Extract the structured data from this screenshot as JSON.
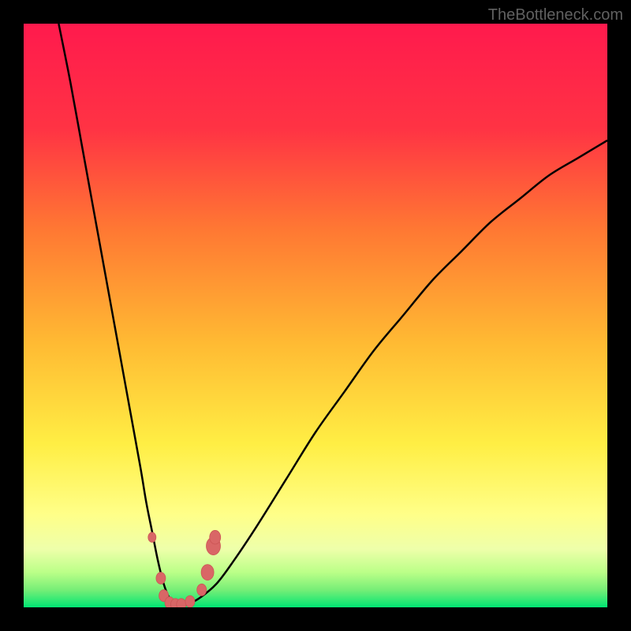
{
  "watermark": "TheBottleneck.com",
  "colors": {
    "bg": "#000000",
    "gradient_top": "#ff1a4d",
    "gradient_mid1": "#ff8a33",
    "gradient_mid2": "#ffd633",
    "gradient_mid3": "#ffff66",
    "gradient_low": "#ccff66",
    "gradient_bottom": "#00e673",
    "curve": "#000000",
    "markers_fill": "#d96666",
    "markers_stroke": "#cc5555"
  },
  "chart_data": {
    "type": "line",
    "title": "",
    "xlabel": "",
    "ylabel": "",
    "xlim": [
      0,
      100
    ],
    "ylim": [
      0,
      100
    ],
    "series": [
      {
        "name": "bottleneck-curve",
        "x": [
          6,
          8,
          10,
          12,
          14,
          16,
          18,
          20,
          21,
          22,
          23,
          24,
          25,
          26,
          27,
          28,
          30,
          33,
          36,
          40,
          45,
          50,
          55,
          60,
          65,
          70,
          75,
          80,
          85,
          90,
          95,
          100
        ],
        "y": [
          100,
          90,
          79,
          68,
          57,
          46,
          35,
          24,
          18,
          13,
          8,
          4,
          1.5,
          0.5,
          0.3,
          0.5,
          1.5,
          4,
          8,
          14,
          22,
          30,
          37,
          44,
          50,
          56,
          61,
          66,
          70,
          74,
          77,
          80
        ]
      }
    ],
    "markers": [
      {
        "x": 22.0,
        "y": 12.0,
        "r": 5
      },
      {
        "x": 23.5,
        "y": 5.0,
        "r": 6
      },
      {
        "x": 24.0,
        "y": 2.0,
        "r": 6
      },
      {
        "x": 25.0,
        "y": 0.8,
        "r": 6
      },
      {
        "x": 26.0,
        "y": 0.5,
        "r": 6
      },
      {
        "x": 27.0,
        "y": 0.5,
        "r": 6
      },
      {
        "x": 28.5,
        "y": 1.0,
        "r": 6
      },
      {
        "x": 30.5,
        "y": 3.0,
        "r": 6
      },
      {
        "x": 31.5,
        "y": 6.0,
        "r": 8
      },
      {
        "x": 32.5,
        "y": 10.5,
        "r": 9
      },
      {
        "x": 32.8,
        "y": 12.0,
        "r": 7
      }
    ]
  }
}
